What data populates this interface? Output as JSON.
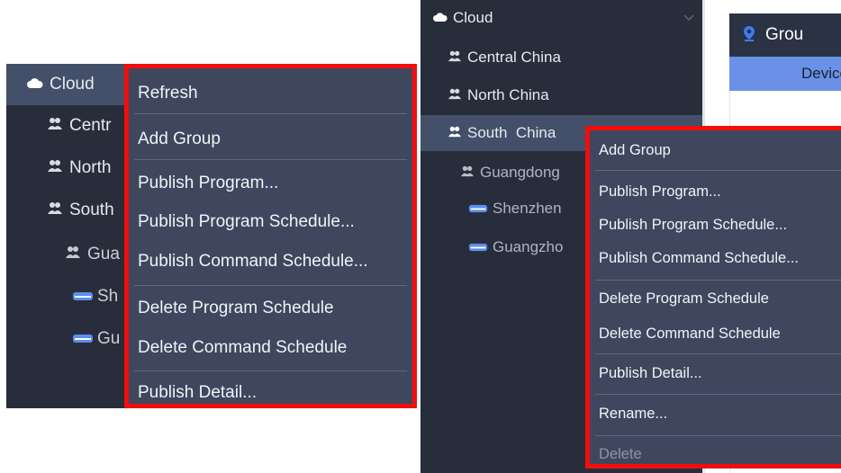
{
  "left": {
    "tree": {
      "root": "Cloud",
      "items": [
        {
          "label": "Centr"
        },
        {
          "label": "North"
        },
        {
          "label": "South"
        },
        {
          "label": "Gua"
        },
        {
          "label": "Sh"
        },
        {
          "label": "Gu"
        }
      ]
    },
    "menu": {
      "refresh": "Refresh",
      "add_group": "Add Group",
      "publish_program": "Publish Program...",
      "publish_program_schedule": "Publish Program Schedule...",
      "publish_command_schedule": "Publish Command Schedule...",
      "delete_program_schedule": "Delete Program Schedule",
      "delete_command_schedule": "Delete Command Schedule",
      "publish_detail": "Publish Detail..."
    }
  },
  "right": {
    "tree": {
      "root": "Cloud",
      "items": [
        {
          "label": "Central China"
        },
        {
          "label": "North China"
        },
        {
          "label": "South  China"
        },
        {
          "label": "Guangdong"
        },
        {
          "label": "Shenzhen"
        },
        {
          "label": "Guangzho"
        }
      ]
    },
    "header": {
      "title": "Grou",
      "tab": "Device N"
    },
    "menu": {
      "add_group": "Add Group",
      "publish_program": "Publish Program...",
      "publish_program_schedule": "Publish Program Schedule...",
      "publish_command_schedule": "Publish Command Schedule...",
      "delete_program_schedule": "Delete Program Schedule",
      "delete_command_schedule": "Delete Command Schedule",
      "publish_detail": "Publish Detail...",
      "rename": "Rename...",
      "delete": "Delete"
    }
  },
  "colors": {
    "tree_bg": "#282d3c",
    "selected_row": "#44506a",
    "menu_bg": "#3e475e",
    "highlight_border": "#f20d0d",
    "device_tab": "#6a91e8",
    "pin_icon": "#3d7cf0"
  },
  "icons": [
    "cloud-icon",
    "group-icon",
    "device-icon",
    "location-pin-icon",
    "chevron-down-icon"
  ]
}
